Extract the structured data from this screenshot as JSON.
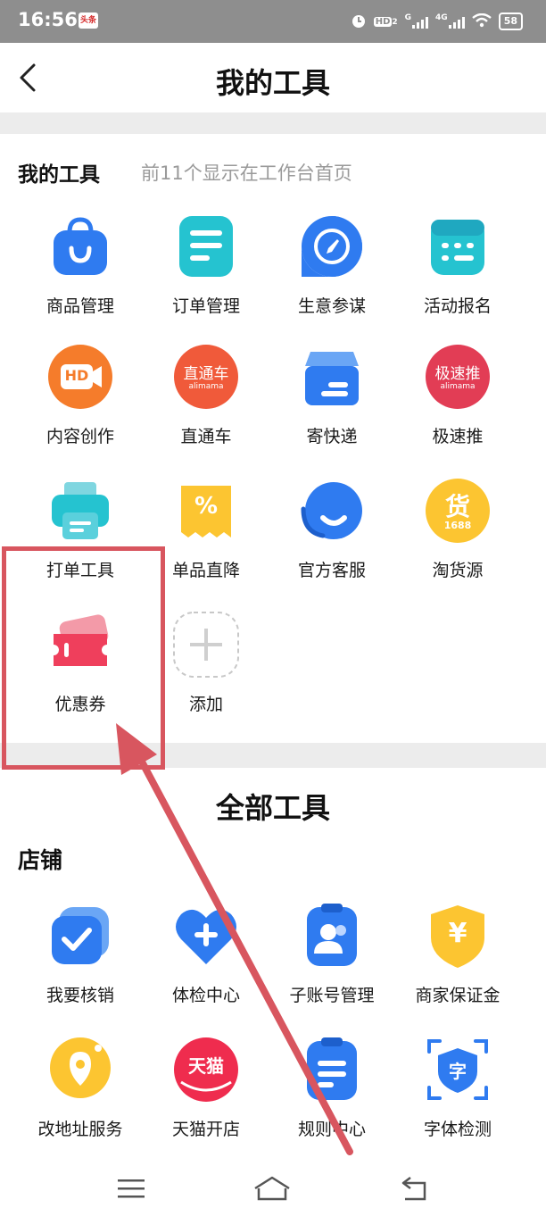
{
  "status_bar": {
    "time": "16:56",
    "app_badge": "头条",
    "network_hd": "HD",
    "network_hd_sub": "2",
    "network_g": "G",
    "network_4g": "4G",
    "battery": "58"
  },
  "header": {
    "title": "我的工具"
  },
  "my_tools": {
    "title": "我的工具",
    "hint": "前11个显示在工作台首页",
    "items": [
      {
        "label": "商品管理"
      },
      {
        "label": "订单管理"
      },
      {
        "label": "生意参谋"
      },
      {
        "label": "活动报名"
      },
      {
        "label": "内容创作",
        "badge": "HD"
      },
      {
        "label": "直通车",
        "badge": "直通车",
        "badge_sub": "alimama"
      },
      {
        "label": "寄快递"
      },
      {
        "label": "极速推",
        "badge": "极速推",
        "badge_sub": "alimama"
      },
      {
        "label": "打单工具"
      },
      {
        "label": "单品直降",
        "badge": "%"
      },
      {
        "label": "官方客服"
      },
      {
        "label": "淘货源",
        "badge": "货",
        "badge_sub": "1688"
      },
      {
        "label": "优惠券"
      },
      {
        "label": "添加"
      }
    ]
  },
  "all_tools": {
    "title": "全部工具",
    "category": "店铺",
    "items": [
      {
        "label": "我要核销"
      },
      {
        "label": "体检中心"
      },
      {
        "label": "子账号管理"
      },
      {
        "label": "商家保证金",
        "badge": "¥"
      },
      {
        "label": "改地址服务"
      },
      {
        "label": "天猫开店",
        "badge": "天猫"
      },
      {
        "label": "规则中心"
      },
      {
        "label": "字体检测",
        "badge": "字"
      }
    ]
  },
  "colors": {
    "blue": "#2f7bf0",
    "teal": "#25c3d0",
    "orange": "#f57c2b",
    "red": "#e94d5b",
    "yellow": "#fcc531",
    "annotation": "#d8565f"
  }
}
